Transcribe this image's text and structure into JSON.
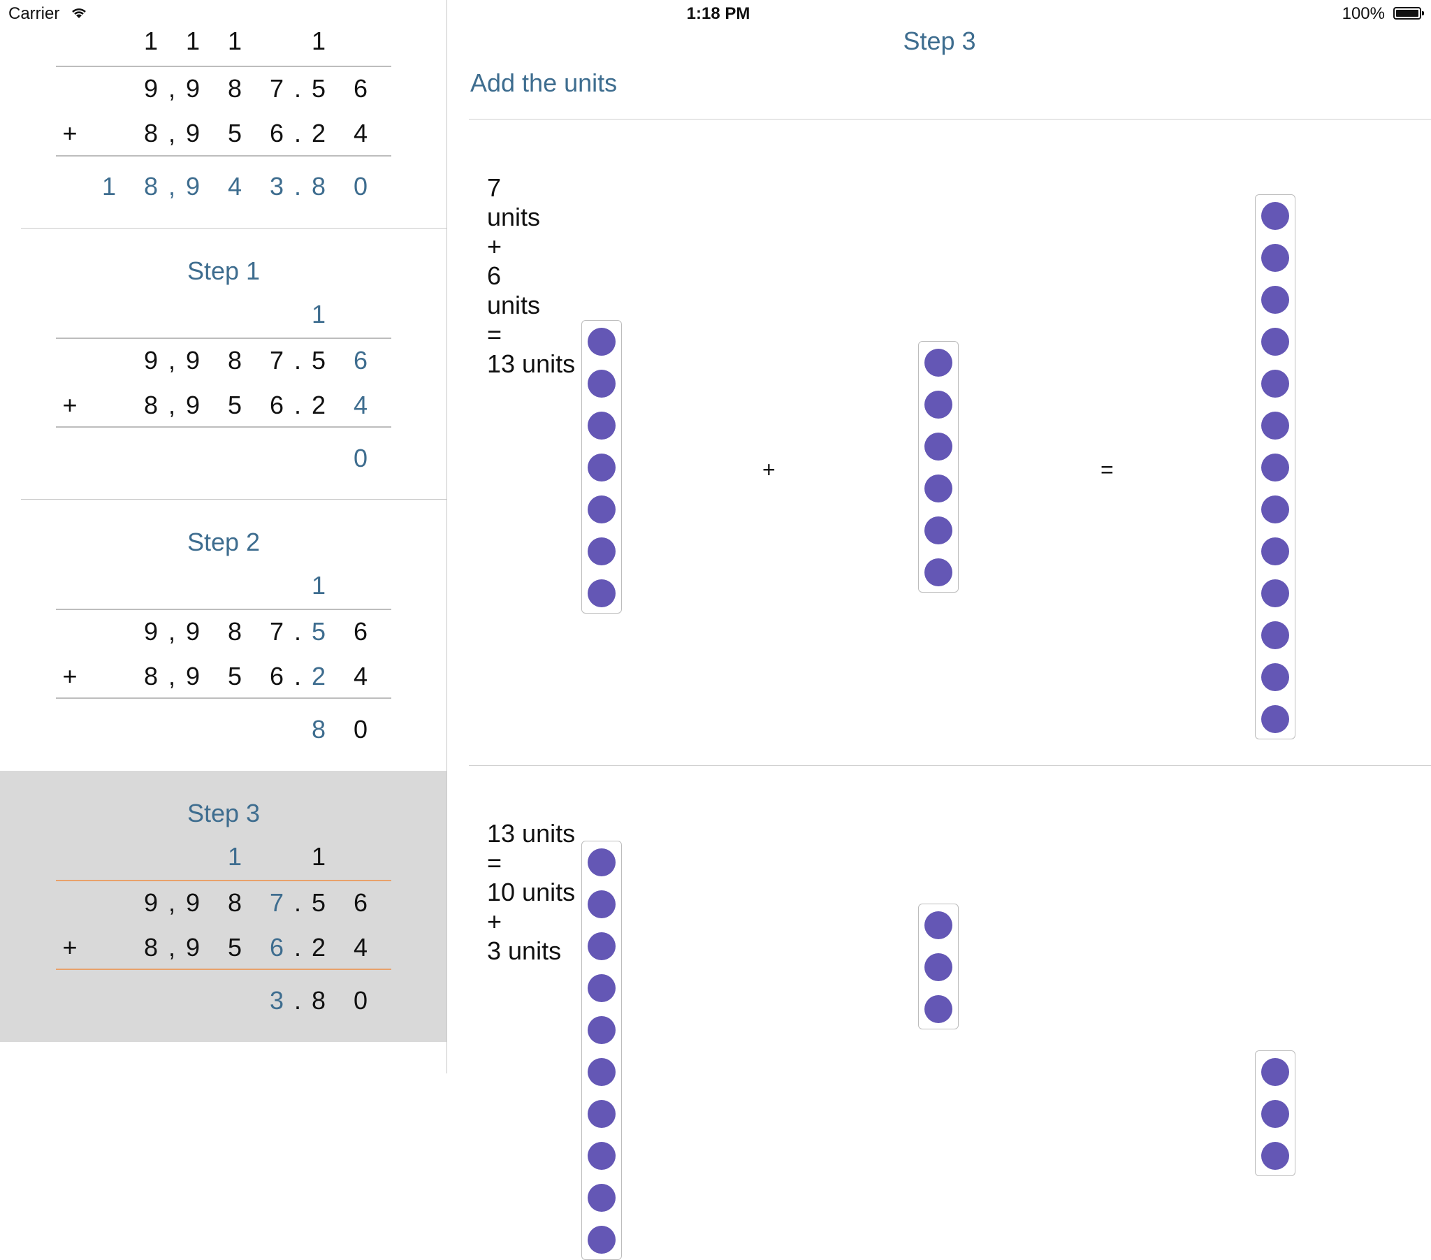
{
  "status": {
    "carrier": "Carrier",
    "time": "1:18 PM",
    "battery": "100%"
  },
  "sidebar": {
    "summary": {
      "carries": [
        "1",
        "1",
        "1",
        "",
        "1",
        ""
      ],
      "top": [
        "9",
        ",",
        "9",
        "8",
        "7",
        ".",
        "5",
        "6"
      ],
      "op": "+",
      "bottom": [
        "8",
        ",",
        "9",
        "5",
        "6",
        ".",
        "2",
        "4"
      ],
      "result": [
        "1",
        "8",
        ",",
        "9",
        "4",
        "3",
        ".",
        "8",
        "0"
      ]
    },
    "steps": [
      {
        "title": "Step 1",
        "carries": [
          "",
          "",
          "",
          "",
          "1",
          ""
        ],
        "top": [
          "9",
          ",",
          "9",
          "8",
          "7",
          ".",
          "5",
          "6"
        ],
        "op": "+",
        "bottom": [
          "8",
          ",",
          "9",
          "5",
          "6",
          ".",
          "2",
          "4"
        ],
        "result": [
          "0"
        ]
      },
      {
        "title": "Step 2",
        "carries": [
          "",
          "",
          "",
          "",
          "1",
          ""
        ],
        "top": [
          "9",
          ",",
          "9",
          "8",
          "7",
          ".",
          "5",
          "6"
        ],
        "op": "+",
        "bottom": [
          "8",
          ",",
          "9",
          "5",
          "6",
          ".",
          "2",
          "4"
        ],
        "result": [
          "8",
          "0"
        ]
      },
      {
        "title": "Step 3",
        "carries": [
          "",
          "",
          "1",
          "",
          "1",
          ""
        ],
        "top": [
          "9",
          ",",
          "9",
          "8",
          "7",
          ".",
          "5",
          "6"
        ],
        "op": "+",
        "bottom": [
          "8",
          ",",
          "9",
          "5",
          "6",
          ".",
          "2",
          "4"
        ],
        "result": [
          "3",
          ".",
          "8",
          "0"
        ]
      }
    ]
  },
  "main": {
    "title": "Step 3",
    "subtitle": "Add the units",
    "equation1": {
      "a": "7",
      "a_unit": "units",
      "plus": "+",
      "b": "6",
      "b_unit": "units",
      "eq": "=",
      "c": "13 units"
    },
    "equation2": {
      "a": "13 units",
      "eq": "=",
      "b": "10 units",
      "plus": "+",
      "c": "3 units"
    },
    "group1": {
      "left_count": 7,
      "right_count": 6,
      "result_count": 13,
      "plus": "+",
      "equals": "="
    },
    "group2": {
      "left_count": 10,
      "right_count": 3
    },
    "colors": {
      "accent": "#3e6d8f",
      "dot": "#6457b5",
      "highlight_rule": "#e8a16b",
      "selected_bg": "#d9d9d9"
    }
  }
}
